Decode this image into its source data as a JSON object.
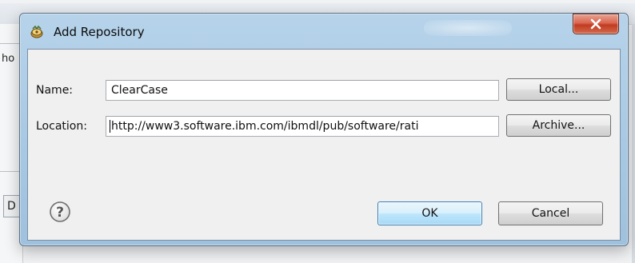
{
  "background": {
    "left_text_top": "ho",
    "left_text_bottom": "D"
  },
  "dialog": {
    "title": "Add Repository",
    "title_icon": "repository-icon",
    "close_icon": "close-icon",
    "close_color": "#c23b22"
  },
  "form": {
    "name_label": "Name:",
    "name_value": "ClearCase",
    "location_label": "Location:",
    "location_value": "http://www3.software.ibm.com/ibmdl/pub/software/rati"
  },
  "buttons": {
    "local": "Local...",
    "archive": "Archive...",
    "ok": "OK",
    "cancel": "Cancel",
    "help_icon": "help-icon",
    "help_symbol": "?"
  },
  "colors": {
    "ok_button_accent": "#3c7fb1",
    "titlebar": "#a7c8e3"
  }
}
